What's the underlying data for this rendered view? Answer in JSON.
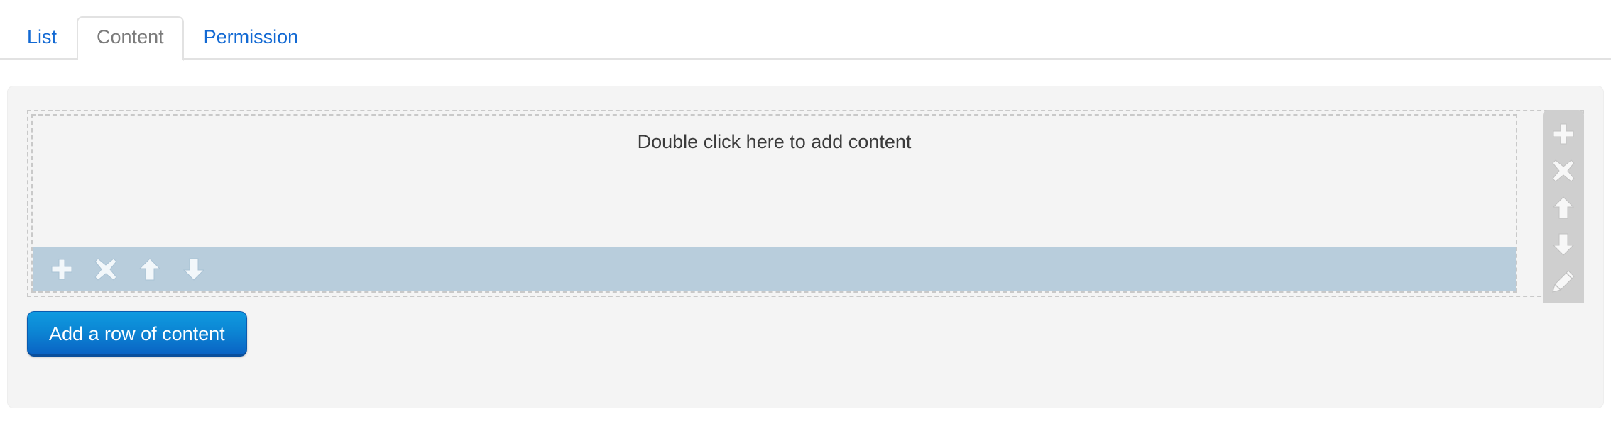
{
  "tabs": [
    {
      "label": "List",
      "active": false
    },
    {
      "label": "Content",
      "active": true
    },
    {
      "label": "Permission",
      "active": false
    }
  ],
  "editor": {
    "placeholder_text": "Double click here to add content",
    "row_toolbar": [
      {
        "icon": "plus-icon",
        "title": "Add"
      },
      {
        "icon": "close-icon",
        "title": "Delete"
      },
      {
        "icon": "arrow-up-icon",
        "title": "Move up"
      },
      {
        "icon": "arrow-down-icon",
        "title": "Move down"
      }
    ],
    "side_toolbar": [
      {
        "icon": "plus-icon",
        "title": "Add"
      },
      {
        "icon": "close-icon",
        "title": "Delete"
      },
      {
        "icon": "arrow-up-icon",
        "title": "Move up"
      },
      {
        "icon": "arrow-down-icon",
        "title": "Move down"
      },
      {
        "icon": "pencil-icon",
        "title": "Edit"
      }
    ]
  },
  "actions": {
    "add_row_label": "Add a row of content"
  },
  "colors": {
    "tab_link": "#1269d3",
    "tab_active_text": "#7b7b7b",
    "panel_bg": "#f4f4f4",
    "row_toolbar_bg": "#b8cddc",
    "side_toolbar_bg": "#cfcfcf",
    "button_blue_top": "#0f9ae0",
    "button_blue_bottom": "#0a63c4",
    "dashed_border": "#c9c9c9"
  }
}
